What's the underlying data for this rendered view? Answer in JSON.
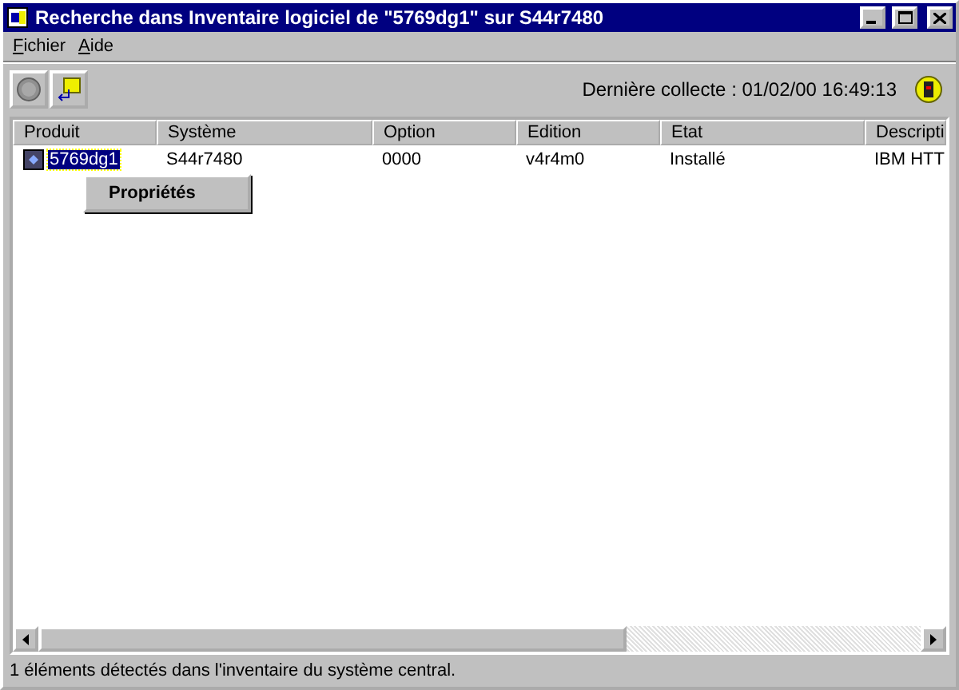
{
  "window": {
    "title": "Recherche dans Inventaire logiciel de \"5769dg1\" sur S44r7480"
  },
  "menu": [
    "Fichier",
    "Aide"
  ],
  "toolbar": {
    "last_collect": "Dernière collecte : 01/02/00 16:49:13"
  },
  "table": {
    "columns": [
      "Produit",
      "Système",
      "Option",
      "Edition",
      "Etat",
      "Descripti"
    ],
    "rows": [
      {
        "cells": [
          "5769dg1",
          "S44r7480",
          "0000",
          "v4r4m0",
          "Installé",
          "IBM HTT"
        ],
        "selected": true
      }
    ]
  },
  "context_menu": {
    "items": [
      {
        "label": "Propriétés"
      }
    ]
  },
  "status_bar": "1 éléments détectés dans l'inventaire du système central."
}
